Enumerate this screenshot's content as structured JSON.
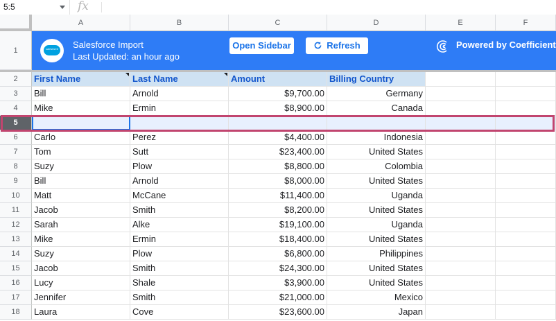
{
  "formula_bar": {
    "name_box": "5:5",
    "fx": "fx"
  },
  "columns": [
    "A",
    "B",
    "C",
    "D",
    "E",
    "F"
  ],
  "row_numbers": [
    "1",
    "2",
    "3",
    "4",
    "5",
    "6",
    "7",
    "8",
    "9",
    "10",
    "11",
    "12",
    "13",
    "14",
    "15",
    "16",
    "17",
    "18"
  ],
  "banner": {
    "logo_text": "salesforce",
    "title": "Salesforce Import",
    "subtitle": "Last Updated: an hour ago",
    "open_sidebar": "Open Sidebar",
    "refresh": "Refresh",
    "powered_by": "Powered by Coefficient"
  },
  "table": {
    "headers": [
      "First Name",
      "Last Name",
      "Amount",
      "Billing Country"
    ],
    "rows": [
      [
        "Bill",
        "Arnold",
        "$9,700.00",
        "Germany"
      ],
      [
        "Mike",
        "Ermin",
        "$8,900.00",
        "Canada"
      ],
      [
        "",
        "",
        "",
        ""
      ],
      [
        "Carlo",
        "Perez",
        "$4,400.00",
        "Indonesia"
      ],
      [
        "Tom",
        "Sutt",
        "$23,400.00",
        "United States"
      ],
      [
        "Suzy",
        "Plow",
        "$8,800.00",
        "Colombia"
      ],
      [
        "Bill",
        "Arnold",
        "$8,000.00",
        "United States"
      ],
      [
        "Matt",
        "McCane",
        "$11,400.00",
        "Uganda"
      ],
      [
        "Jacob",
        "Smith",
        "$8,200.00",
        "United States"
      ],
      [
        "Sarah",
        "Alke",
        "$19,100.00",
        "Uganda"
      ],
      [
        "Mike",
        "Ermin",
        "$18,400.00",
        "United States"
      ],
      [
        "Suzy",
        "Plow",
        "$6,800.00",
        "Philippines"
      ],
      [
        "Jacob",
        "Smith",
        "$24,300.00",
        "United States"
      ],
      [
        "Lucy",
        "Shale",
        "$3,900.00",
        "United States"
      ],
      [
        "Jennifer",
        "Smith",
        "$21,000.00",
        "Mexico"
      ],
      [
        "Laura",
        "Cove",
        "$23,600.00",
        "Japan"
      ]
    ]
  },
  "colors": {
    "banner": "#2e7cf6",
    "header_fill": "#cfe2f3",
    "header_text": "#1155cc",
    "highlight": "#c1456f",
    "selection": "#1a73e8"
  }
}
